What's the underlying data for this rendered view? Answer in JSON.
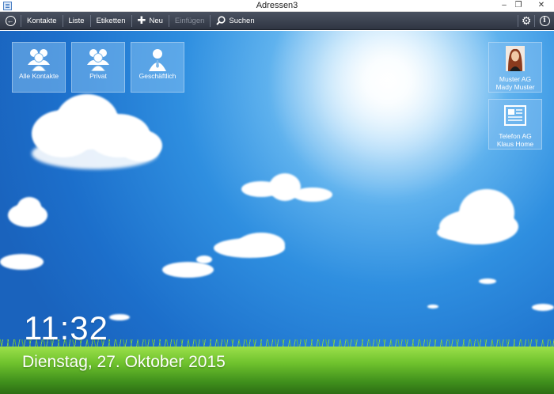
{
  "window": {
    "title": "Adressen3"
  },
  "toolbar": {
    "contacts": "Kontakte",
    "list": "Liste",
    "labels": "Etiketten",
    "new": "Neu",
    "insert": "Einfügen",
    "search": "Suchen"
  },
  "tiles": {
    "all_contacts": "Alle Kontakte",
    "private": "Privat",
    "business": "Geschäftlich",
    "contact1_line1": "Muster AG",
    "contact1_line2": "Mady Muster",
    "contact2_line1": "Telefon AG",
    "contact2_line2": "Klaus Home"
  },
  "clock": {
    "time": "11:32",
    "date": "Dienstag, 27. Oktober 2015"
  },
  "colors": {
    "toolbar": "#353b48",
    "sky": "#2f8fe0",
    "grass": "#6fc22d"
  }
}
